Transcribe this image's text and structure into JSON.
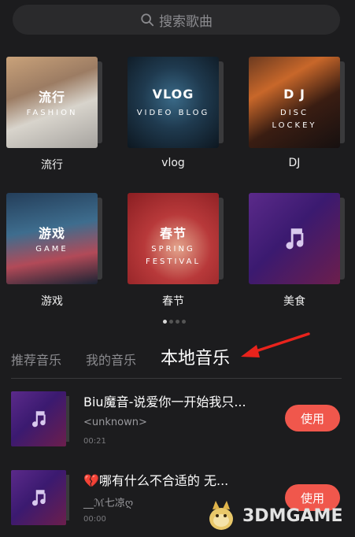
{
  "search": {
    "placeholder": "搜索歌曲"
  },
  "categories": [
    {
      "title": "流行",
      "subtitle": "FASHION",
      "label": "流行"
    },
    {
      "title": "VLOG",
      "subtitle": "VIDEO BLOG",
      "label": "vlog"
    },
    {
      "title": "D J",
      "subtitle": "DISC LOCKEY",
      "label": "DJ"
    },
    {
      "title": "游戏",
      "subtitle": "GAME",
      "label": "游戏"
    },
    {
      "title": "春节",
      "subtitle": "SPRING FESTIVAL",
      "label": "春节"
    },
    {
      "title": "",
      "subtitle": "",
      "label": "美食"
    }
  ],
  "pager": {
    "current_page": 1,
    "page_count": 4
  },
  "tabs": [
    {
      "label": "推荐音乐"
    },
    {
      "label": "我的音乐"
    },
    {
      "label": "本地音乐",
      "active": true
    }
  ],
  "songs": [
    {
      "title": "Biu魔音-说爱你一开始我只...",
      "artist": "<unknown>",
      "duration": "00:21",
      "action": "使用"
    },
    {
      "title": "💔哪有什么不合适的 无...",
      "artist": "__ℳ七凉ღ",
      "duration": "00:00",
      "action": "使用"
    }
  ],
  "watermark": {
    "text": "3DMGAME"
  },
  "colors": {
    "accent": "#f0574c",
    "background": "#1c1c1e",
    "annotation_arrow": "#e8231c"
  }
}
